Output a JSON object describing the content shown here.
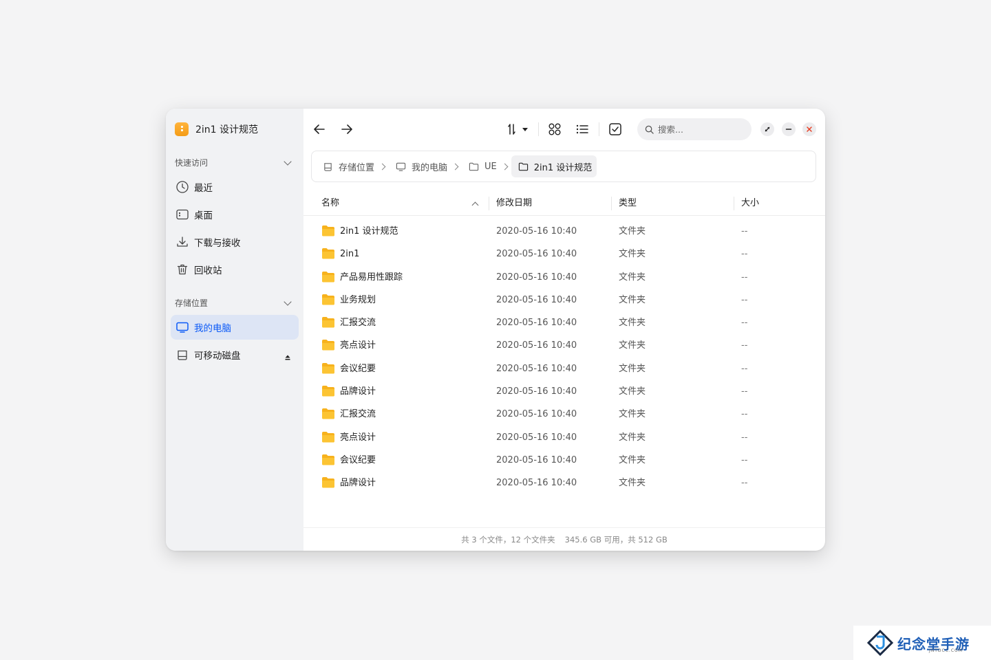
{
  "app": {
    "title": "2in1 设计规范",
    "accent": "#0a59f7",
    "logo_color": "#f7a21c"
  },
  "sidebar": {
    "quick_access": {
      "label": "快速访问",
      "items": [
        {
          "label": "最近",
          "icon": "clock-icon"
        },
        {
          "label": "桌面",
          "icon": "desktop-icon"
        },
        {
          "label": "下载与接收",
          "icon": "download-icon"
        },
        {
          "label": "回收站",
          "icon": "trash-icon"
        }
      ]
    },
    "storage": {
      "label": "存储位置",
      "items": [
        {
          "label": "我的电脑",
          "icon": "monitor-icon",
          "active": true
        },
        {
          "label": "可移动磁盘",
          "icon": "drive-icon"
        }
      ]
    }
  },
  "toolbar": {
    "back": "back-arrow-icon",
    "forward": "forward-arrow-icon",
    "sort": "sort-icon",
    "grid_view": "grid-view-icon",
    "list_view": "list-view-icon",
    "select": "checkbox-icon",
    "search_placeholder": "搜索..."
  },
  "breadcrumb": [
    {
      "label": "存储位置",
      "icon": "drive-icon"
    },
    {
      "label": "我的电脑",
      "icon": "monitor-icon"
    },
    {
      "label": "UE",
      "icon": "folder-icon"
    },
    {
      "label": "2in1 设计规范",
      "icon": "folder-icon",
      "current": true
    }
  ],
  "table": {
    "columns": [
      "名称",
      "修改日期",
      "类型",
      "大小"
    ],
    "rows": [
      {
        "name": "2in1 设计规范",
        "date": "2020-05-16  10:40",
        "type": "文件夹",
        "size": "--"
      },
      {
        "name": "2in1",
        "date": "2020-05-16  10:40",
        "type": "文件夹",
        "size": "--"
      },
      {
        "name": "产品易用性跟踪",
        "date": "2020-05-16  10:40",
        "type": "文件夹",
        "size": "--"
      },
      {
        "name": "业务规划",
        "date": "2020-05-16  10:40",
        "type": "文件夹",
        "size": "--"
      },
      {
        "name": "汇报交流",
        "date": "2020-05-16  10:40",
        "type": "文件夹",
        "size": "--"
      },
      {
        "name": "亮点设计",
        "date": "2020-05-16  10:40",
        "type": "文件夹",
        "size": "--"
      },
      {
        "name": "会议纪要",
        "date": "2020-05-16  10:40",
        "type": "文件夹",
        "size": "--"
      },
      {
        "name": "品牌设计",
        "date": "2020-05-16  10:40",
        "type": "文件夹",
        "size": "--"
      },
      {
        "name": "汇报交流",
        "date": "2020-05-16  10:40",
        "type": "文件夹",
        "size": "--"
      },
      {
        "name": "亮点设计",
        "date": "2020-05-16  10:40",
        "type": "文件夹",
        "size": "--"
      },
      {
        "name": "会议纪要",
        "date": "2020-05-16  10:40",
        "type": "文件夹",
        "size": "--"
      },
      {
        "name": "品牌设计",
        "date": "2020-05-16  10:40",
        "type": "文件夹",
        "size": "--"
      }
    ]
  },
  "status": {
    "counts": "共 3 个文件，12 个文件夹",
    "space": "345.6 GB 可用，共 512 GB"
  },
  "watermark": {
    "text": "纪念堂手游",
    "sub": "JNTDCC.COM"
  }
}
